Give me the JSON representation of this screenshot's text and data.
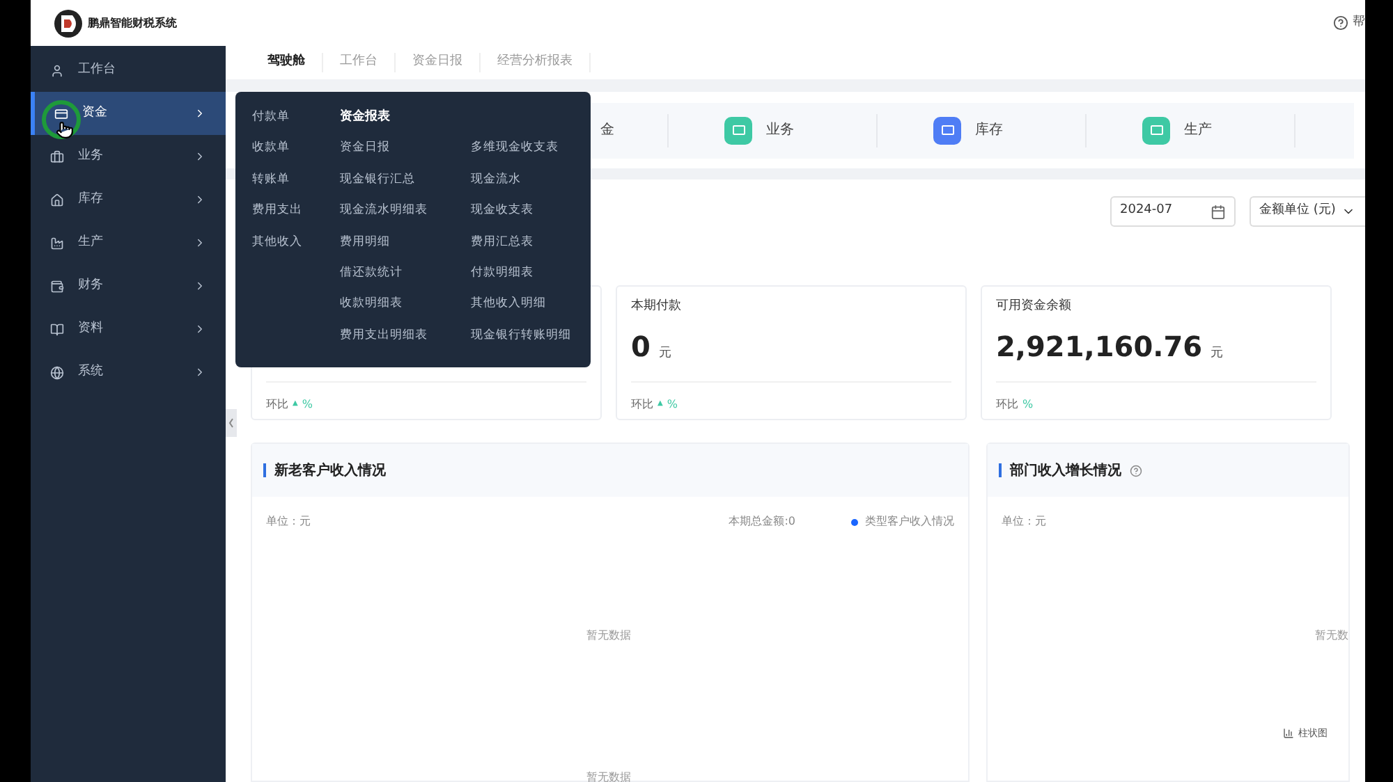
{
  "header": {
    "logo_text": "鹏鼎智能财税系统",
    "help": "帮"
  },
  "sidebar": {
    "items": [
      {
        "label": "工作台",
        "selected": false,
        "has_submenu": false
      },
      {
        "label": "资金",
        "selected": true,
        "has_submenu": true
      },
      {
        "label": "业务",
        "selected": false,
        "has_submenu": true
      },
      {
        "label": "库存",
        "selected": false,
        "has_submenu": true
      },
      {
        "label": "生产",
        "selected": false,
        "has_submenu": true
      },
      {
        "label": "财务",
        "selected": false,
        "has_submenu": true
      },
      {
        "label": "资料",
        "selected": false,
        "has_submenu": true
      },
      {
        "label": "系统",
        "selected": false,
        "has_submenu": true
      }
    ]
  },
  "tabs": [
    {
      "label": "驾驶舱",
      "selected": true
    },
    {
      "label": "工作台",
      "selected": false
    },
    {
      "label": "资金日报",
      "selected": false
    },
    {
      "label": "经营分析报表",
      "selected": false
    }
  ],
  "quick_access": [
    {
      "label": "金"
    },
    {
      "label": "业务",
      "color": "#3ec9a4"
    },
    {
      "label": "库存",
      "color": "#4f7df5"
    },
    {
      "label": "生产",
      "color": "#3ec9a4"
    }
  ],
  "flyout": {
    "column_1": [
      "付款单",
      "收款单",
      "转账单",
      "费用支出",
      "其他收入"
    ],
    "report_title": "资金报表",
    "column_2": [
      "资金日报",
      "现金银行汇总",
      "现金流水明细表",
      "费用明细",
      "借还款统计",
      "收款明细表",
      "费用支出明细表"
    ],
    "column_3": [
      "多维现金收支表",
      "现金流水",
      "现金收支表",
      "费用汇总表",
      "付款明细表",
      "其他收入明细",
      "现金银行转账明细"
    ]
  },
  "filters": {
    "month": "2024-07",
    "unit": "金额单位 (元)"
  },
  "stat_cards": [
    {
      "trend_label": "环比",
      "arrow": "▲",
      "trend_unit": "%"
    },
    {
      "title": "本期付款",
      "value": "0",
      "unit": "元",
      "trend_label": "环比",
      "arrow": "▲",
      "trend_unit": "%"
    },
    {
      "title": "可用资金余额",
      "value": "2,921,160.76",
      "unit": "元",
      "trend_label": "环比",
      "trend_unit": "%"
    }
  ],
  "panels": [
    {
      "title": "新老客户收入情况",
      "help": false,
      "unit_label": "单位：元",
      "total": "本期总金额:0",
      "legend": {
        "label": "类型客户收入情况",
        "color": "#1a66ff"
      },
      "empty_texts": [
        "暂无数据",
        "暂无数据"
      ]
    },
    {
      "title": "部门收入增长情况",
      "help": true,
      "unit_label": "单位：元",
      "empty_texts": [
        "暂无数"
      ],
      "chart_switch": "柱状图"
    }
  ]
}
